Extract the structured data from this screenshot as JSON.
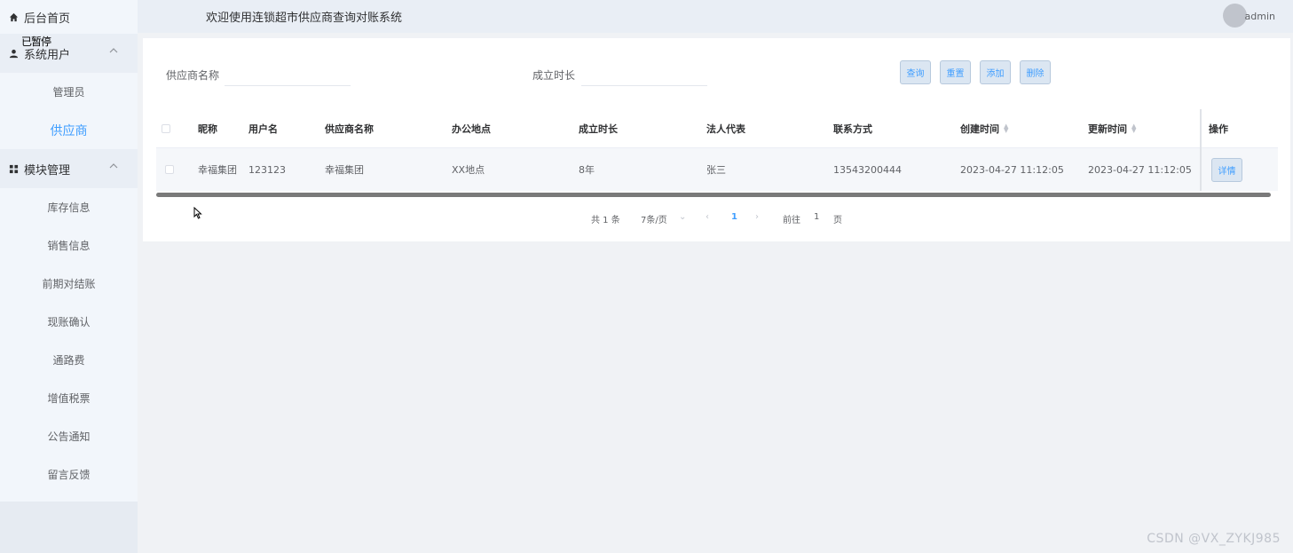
{
  "sidebar": {
    "home_label": "后台首页",
    "stray_text": "已暂停",
    "groups": [
      {
        "label": "系统用户",
        "items": [
          "管理员",
          "供应商"
        ],
        "active": "供应商"
      },
      {
        "label": "模块管理",
        "items": [
          "库存信息",
          "销售信息",
          "前期对结账",
          "现账确认",
          "通路费",
          "增值税票",
          "公告通知",
          "留言反馈"
        ]
      }
    ]
  },
  "header": {
    "title": "欢迎使用连锁超市供应商查询对账系统",
    "username": "admin"
  },
  "search": {
    "supplier_name_label": "供应商名称",
    "supplier_name_value": "",
    "established_label": "成立时长",
    "established_value": ""
  },
  "buttons": {
    "query": "查询",
    "reset": "重置",
    "add": "添加",
    "delete": "删除"
  },
  "table": {
    "headers": [
      "昵称",
      "用户名",
      "供应商名称",
      "办公地点",
      "成立时长",
      "法人代表",
      "联系方式",
      "创建时间",
      "更新时间",
      "操作"
    ],
    "rows": [
      [
        "幸福集团",
        "123123",
        "幸福集团",
        "XX地点",
        "8年",
        "张三",
        "13543200444",
        "2023-04-27 11:12:05",
        "2023-04-27 11:12:05"
      ]
    ],
    "detail_label": "详情"
  },
  "pagination": {
    "total": "共 1 条",
    "page_size": "7条/页",
    "current_page": "1",
    "goto_label": "前往",
    "goto_value": "1",
    "page_suffix": "页"
  },
  "watermark": "CSDN @VX_ZYKJ985",
  "colors": {
    "accent": "#409eff",
    "sidebar_bg": "#f2f6fb",
    "header_bg": "#e9eef5"
  }
}
